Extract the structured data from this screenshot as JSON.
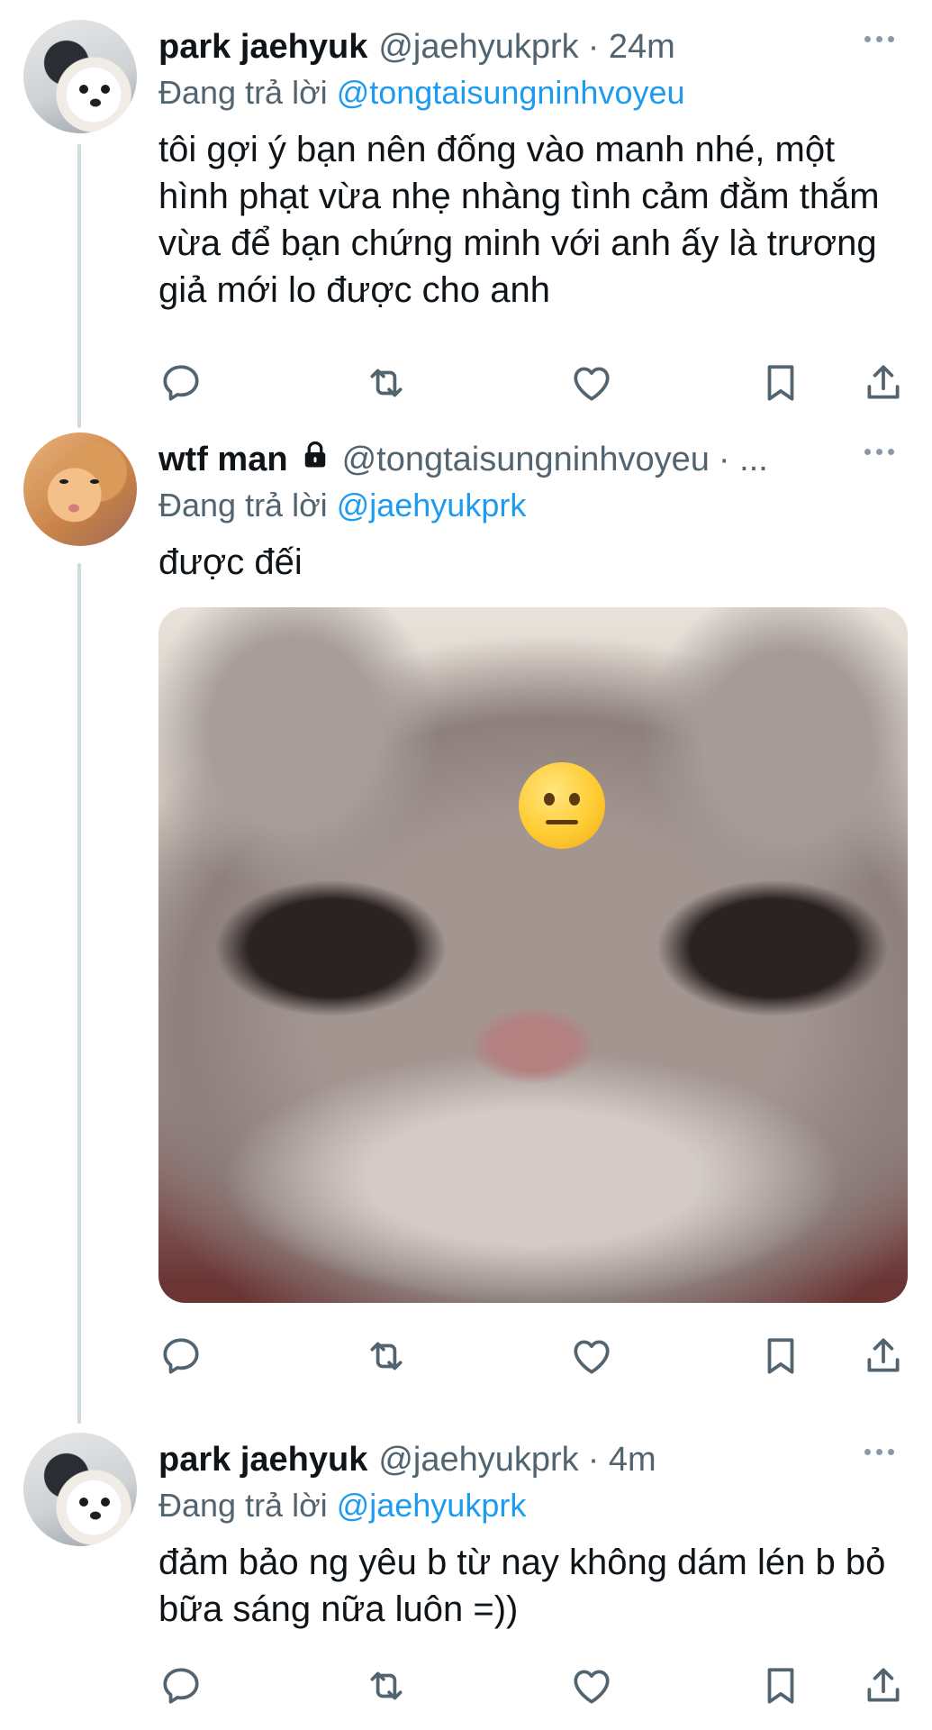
{
  "tweets": [
    {
      "name": "park jaehyuk",
      "handle": "@jaehyukprk",
      "time": "· 24m",
      "reply_prefix": "Đang trả lời ",
      "reply_handle": "@tongtaisungninhvoyeu",
      "text": "tôi gợi ý bạn nên đống vào manh nhé, một hình phạt vừa nhẹ nhàng tình cảm đằm thắm vừa để bạn chứng minh với anh ấy là trương giả mới lo được cho anh",
      "avatar": "dog-avatar"
    },
    {
      "name": "wtf man",
      "handle": "@tongtaisungninhvoyeu",
      "time": "· ...",
      "protected_icon": "lock-icon",
      "reply_prefix": "Đang trả lời ",
      "reply_handle": "@jaehyukprk",
      "text": "được đếi",
      "avatar": "cat-avatar",
      "media": "cat-photo-with-neutral-face-emoji"
    },
    {
      "name": "park jaehyuk",
      "handle": "@jaehyukprk",
      "time": "· 4m",
      "reply_prefix": "Đang trả lời ",
      "reply_handle": "@jaehyukprk",
      "text": "đảm bảo ng yêu b từ nay không dám lén b bỏ bữa sáng nữa luôn =))",
      "avatar": "dog-avatar"
    }
  ],
  "action_icons": [
    "reply-icon",
    "retweet-icon",
    "like-icon",
    "bookmark-icon",
    "share-icon"
  ],
  "colors": {
    "link": "#1d9bf0",
    "secondary": "#536471",
    "text": "#0f1419",
    "thread_line": "#cfd9de"
  }
}
